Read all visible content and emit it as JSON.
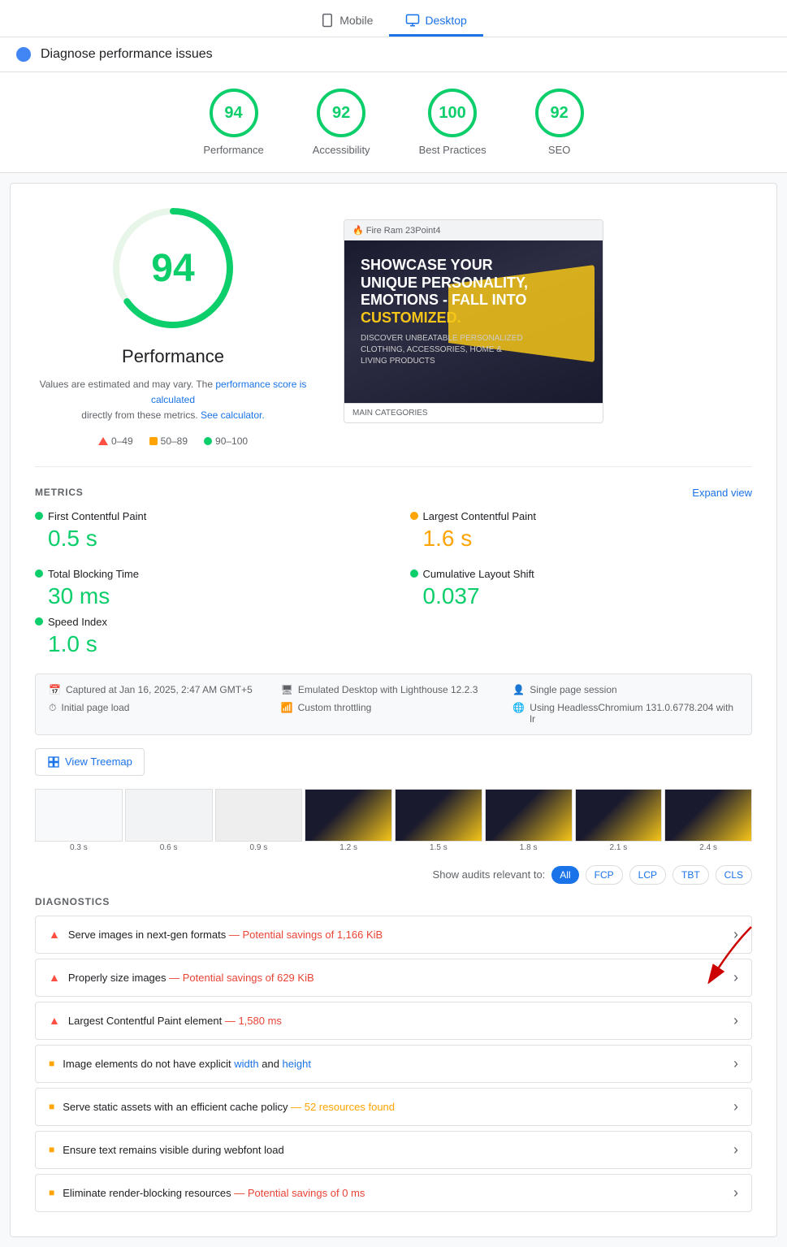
{
  "header": {
    "title": "Diagnose performance issues"
  },
  "device_tabs": [
    {
      "id": "mobile",
      "label": "Mobile",
      "active": false
    },
    {
      "id": "desktop",
      "label": "Desktop",
      "active": true
    }
  ],
  "scores": [
    {
      "id": "performance",
      "value": "94",
      "label": "Performance",
      "color": "green"
    },
    {
      "id": "accessibility",
      "value": "92",
      "label": "Accessibility",
      "color": "green"
    },
    {
      "id": "best-practices",
      "value": "100",
      "label": "Best Practices",
      "color": "green"
    },
    {
      "id": "seo",
      "value": "92",
      "label": "SEO",
      "color": "green"
    }
  ],
  "performance": {
    "score": "94",
    "title": "Performance",
    "note": "Values are estimated and may vary. The",
    "note_link1": "performance score is calculated",
    "note_middle": "directly from these metrics.",
    "note_link2": "See calculator.",
    "legend": [
      {
        "type": "triangle",
        "range": "0–49"
      },
      {
        "type": "square",
        "range": "50–89"
      },
      {
        "type": "circle",
        "range": "90–100"
      }
    ]
  },
  "metrics": {
    "title": "METRICS",
    "expand_label": "Expand view",
    "items": [
      {
        "label": "First Contentful Paint",
        "value": "0.5 s",
        "color": "green"
      },
      {
        "label": "Largest Contentful Paint",
        "value": "1.6 s",
        "color": "orange"
      },
      {
        "label": "Total Blocking Time",
        "value": "30 ms",
        "color": "green"
      },
      {
        "label": "Cumulative Layout Shift",
        "value": "0.037",
        "color": "green"
      },
      {
        "label": "Speed Index",
        "value": "1.0 s",
        "color": "green"
      }
    ]
  },
  "info_bar": {
    "items": [
      {
        "icon": "📅",
        "text": "Captured at Jan 16, 2025, 2:47 AM GMT+5"
      },
      {
        "icon": "🖥",
        "text": "Emulated Desktop with Lighthouse 12.2.3"
      },
      {
        "icon": "👤",
        "text": "Single page session"
      },
      {
        "icon": "⏱",
        "text": "Initial page load"
      },
      {
        "icon": "📶",
        "text": "Custom throttling"
      },
      {
        "icon": "🌐",
        "text": "Using HeadlessChromium 131.0.6778.204 with lr"
      }
    ]
  },
  "treemap_btn": "View Treemap",
  "film_frames": [
    {
      "time": "0.3 s",
      "type": "light"
    },
    {
      "time": "0.6 s",
      "type": "light"
    },
    {
      "time": "0.9 s",
      "type": "light"
    },
    {
      "time": "1.2 s",
      "type": "content"
    },
    {
      "time": "1.5 s",
      "type": "content"
    },
    {
      "time": "1.8 s",
      "type": "content"
    },
    {
      "time": "2.1 s",
      "type": "content"
    },
    {
      "time": "2.4 s",
      "type": "content"
    }
  ],
  "audit_filter": {
    "label": "Show audits relevant to:",
    "buttons": [
      {
        "id": "all",
        "label": "All",
        "active": true
      },
      {
        "id": "fcp",
        "label": "FCP",
        "active": false
      },
      {
        "id": "lcp",
        "label": "LCP",
        "active": false
      },
      {
        "id": "tbt",
        "label": "TBT",
        "active": false
      },
      {
        "id": "cls",
        "label": "CLS",
        "active": false
      }
    ]
  },
  "diagnostics": {
    "title": "DIAGNOSTICS",
    "items": [
      {
        "type": "warning",
        "text": "Serve images in next-gen formats",
        "savings": " — Potential savings of 1,166 KiB",
        "savings_color": "red"
      },
      {
        "type": "warning",
        "text": "Properly size images",
        "savings": " — Potential savings of 629 KiB",
        "savings_color": "red",
        "has_arrow": true
      },
      {
        "type": "warning",
        "text": "Largest Contentful Paint element",
        "savings": " — 1,580 ms",
        "savings_color": "red"
      },
      {
        "type": "orange",
        "text": "Image elements do not have explicit ",
        "link1": "width",
        "between": " and ",
        "link2": "height",
        "savings": "",
        "savings_color": "none"
      },
      {
        "type": "orange",
        "text": "Serve static assets with an efficient cache policy",
        "savings": " — 52 resources found",
        "savings_color": "orange"
      },
      {
        "type": "orange",
        "text": "Ensure text remains visible during webfont load",
        "savings": "",
        "savings_color": "none"
      },
      {
        "type": "orange",
        "text": "Eliminate render-blocking resources",
        "savings": " — Potential savings of 0 ms",
        "savings_color": "red"
      }
    ]
  }
}
